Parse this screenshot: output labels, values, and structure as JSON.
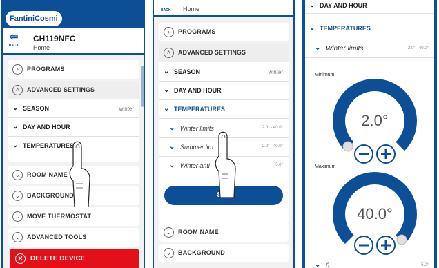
{
  "app": {
    "brand": "FantiniCosmi"
  },
  "device": {
    "back_label": "BACK",
    "name": "CH119NFC",
    "location": "Home"
  },
  "panel1": {
    "programs": "PROGRAMS",
    "advanced_settings": "ADVANCED SETTINGS",
    "season": {
      "label": "SEASON",
      "value": "winter"
    },
    "day_and_hour": "DAY AND HOUR",
    "temperatures": "TEMPERATURES",
    "room_name": "ROOM NAME",
    "background": "BACKGROUND",
    "move_thermostat": "MOVE THERMOSTAT",
    "advanced_tools": "ADVANCED TOOLS",
    "delete_device": "DELETE DEVICE"
  },
  "panel2": {
    "top_back": "BACK",
    "top_home": "Home",
    "programs": "PROGRAMS",
    "advanced_settings": "ADVANCED SETTINGS",
    "season": {
      "label": "SEASON",
      "value": "winter"
    },
    "day_and_hour": "DAY AND HOUR",
    "temperatures": "TEMPERATURES",
    "winter_limits": {
      "label": "Winter limits",
      "value": "2.0° - 40.0°"
    },
    "summer_limits": {
      "label": "Summer lim",
      "value": "2.0° - 40.0°"
    },
    "winter_anti": {
      "label": "Winter anti",
      "value": "5.0°"
    },
    "set": "SET",
    "room_name": "ROOM NAME",
    "background": "BACKGROUND"
  },
  "panel3": {
    "day_and_hour": "DAY AND HOUR",
    "temperatures": "TEMPERATURES",
    "winter_limits": {
      "label": "Winter limits",
      "value": "2.0° - 40.0°"
    },
    "minimum": {
      "label": "Minimum",
      "value": "2.0°"
    },
    "maximum": {
      "label": "Maximum",
      "value": "40.0°"
    },
    "bottom_row": {
      "label": "0",
      "value": "5.0°"
    }
  },
  "colors": {
    "primary": "#0d4f97",
    "danger": "#e3101a",
    "background": "#f2f2f2"
  },
  "icons": [
    "back-arrow-icon",
    "chevron-right-icon",
    "chevron-up-icon",
    "chevron-down-icon",
    "close-icon",
    "minus-icon",
    "plus-icon",
    "hand-pointer-icon"
  ]
}
